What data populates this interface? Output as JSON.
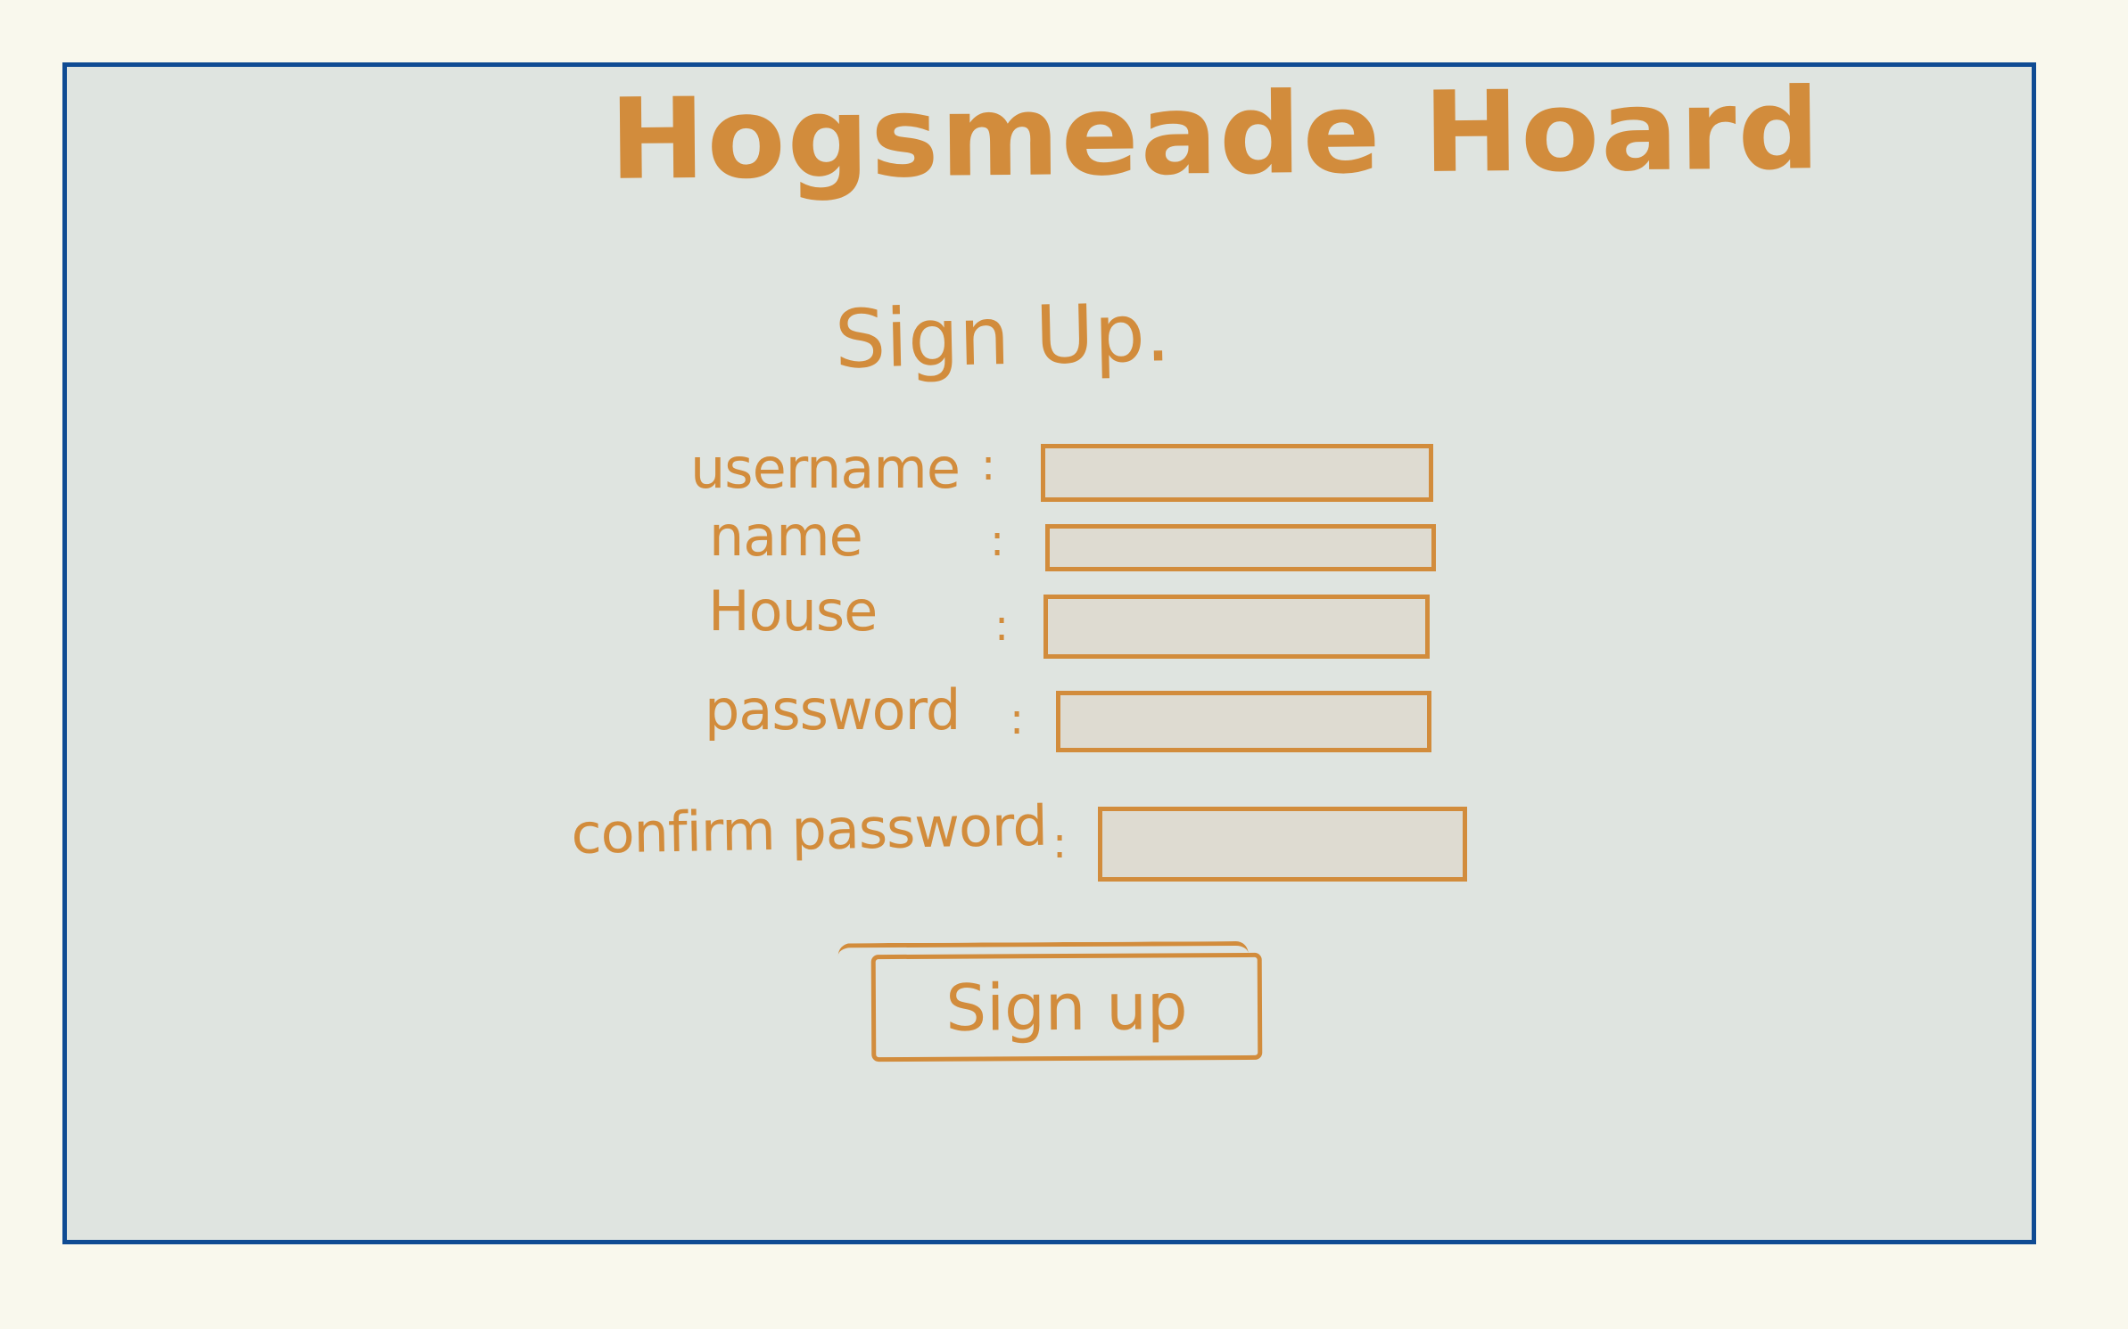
{
  "app": {
    "title": "Hogsmeade Hoard"
  },
  "form": {
    "heading": "Sign Up.",
    "fields": [
      {
        "label": "username",
        "colon": ":",
        "value": "",
        "placeholder": ""
      },
      {
        "label": "name",
        "colon": ":",
        "value": "",
        "placeholder": ""
      },
      {
        "label": "House",
        "colon": ":",
        "value": "",
        "placeholder": ""
      },
      {
        "label": "password",
        "colon": ":",
        "value": "",
        "placeholder": ""
      },
      {
        "label": "confirm password",
        "colon": ":",
        "value": "",
        "placeholder": ""
      }
    ],
    "submit_label": "Sign up"
  },
  "colors": {
    "background": "#f9f8ed",
    "frame_border": "#0f4b93",
    "frame_fill": "#dfe4e0",
    "sketch": "#d28c3c",
    "field_fill": "#dedbd1"
  }
}
